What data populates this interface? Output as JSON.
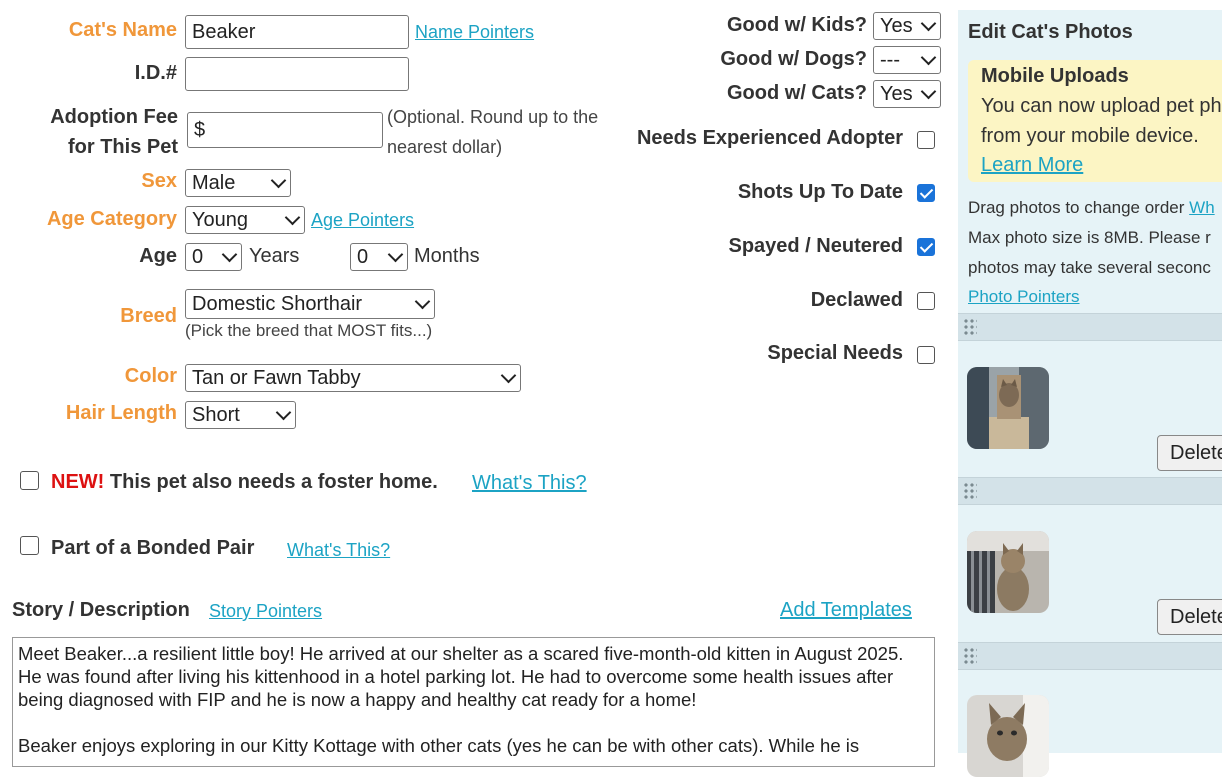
{
  "form": {
    "cat_name_label": "Cat's Name",
    "cat_name_value": "Beaker",
    "name_pointers": "Name Pointers",
    "id_label": "I.D.#",
    "id_value": "",
    "fee_label_1": "Adoption Fee",
    "fee_label_2": "for This Pet",
    "fee_prefix": "$",
    "fee_note_1": "(Optional. Round up to the",
    "fee_note_2": "nearest dollar)",
    "sex_label": "Sex",
    "sex_value": "Male",
    "age_category_label": "Age Category",
    "age_category_value": "Young",
    "age_pointers": "Age Pointers",
    "age_label": "Age",
    "age_years_value": "0",
    "years_text": "Years",
    "age_months_value": "0",
    "months_text": "Months",
    "breed_label": "Breed",
    "breed_value": "Domestic Shorthair",
    "breed_hint": "(Pick the breed that MOST fits...)",
    "color_label": "Color",
    "color_value": "Tan or Fawn Tabby",
    "hair_label": "Hair Length",
    "hair_value": "Short",
    "foster_new": "NEW!",
    "foster_text": "This pet also needs a foster home.",
    "foster_link": "What's This?",
    "bonded_text": "Part of a Bonded Pair",
    "bonded_link": "What's This?",
    "story_label": "Story / Description",
    "story_pointers": "Story Pointers",
    "add_templates": "Add Templates",
    "story_text": "Meet Beaker...a resilient little boy! He arrived at our shelter as a scared five-month-old kitten in August 2025. He was found after living his kittenhood in a hotel parking lot. He had to overcome some health issues after being diagnosed with FIP and he is now a happy and healthy cat ready for a home!\n\nBeaker enjoys exploring in our Kitty Kottage with other cats (yes he can be with other cats). While he is"
  },
  "traits": {
    "kids_label": "Good w/ Kids?",
    "kids_value": "Yes",
    "dogs_label": "Good w/ Dogs?",
    "dogs_value": "---",
    "cats_label": "Good w/ Cats?",
    "cats_value": "Yes",
    "experienced_label": "Needs Experienced Adopter",
    "experienced_checked": false,
    "shots_label": "Shots Up To Date",
    "shots_checked": true,
    "spayed_label": "Spayed / Neutered",
    "spayed_checked": true,
    "declawed_label": "Declawed",
    "declawed_checked": false,
    "special_label": "Special Needs",
    "special_checked": false
  },
  "photos": {
    "title": "Edit Cat's Photos",
    "notice_title": "Mobile Uploads",
    "notice_line_1": "You can now upload pet pho",
    "notice_line_2": "from your mobile device.",
    "learn_more": "Learn More",
    "drag_text": "Drag photos to change order",
    "drag_link": "Wh",
    "max_size_text": "Max photo size is 8MB. Please r",
    "several_text": "photos may take several seconc",
    "photo_pointers": "Photo Pointers",
    "delete_label": "Delete"
  },
  "colors": {
    "label_orange": "#f0973a",
    "link_teal": "#1ca3c4",
    "new_red": "#dd1111",
    "panel_bg": "#e6f3f7",
    "notice_bg": "#fcf5c4",
    "checkbox_blue": "#1a73d9"
  }
}
